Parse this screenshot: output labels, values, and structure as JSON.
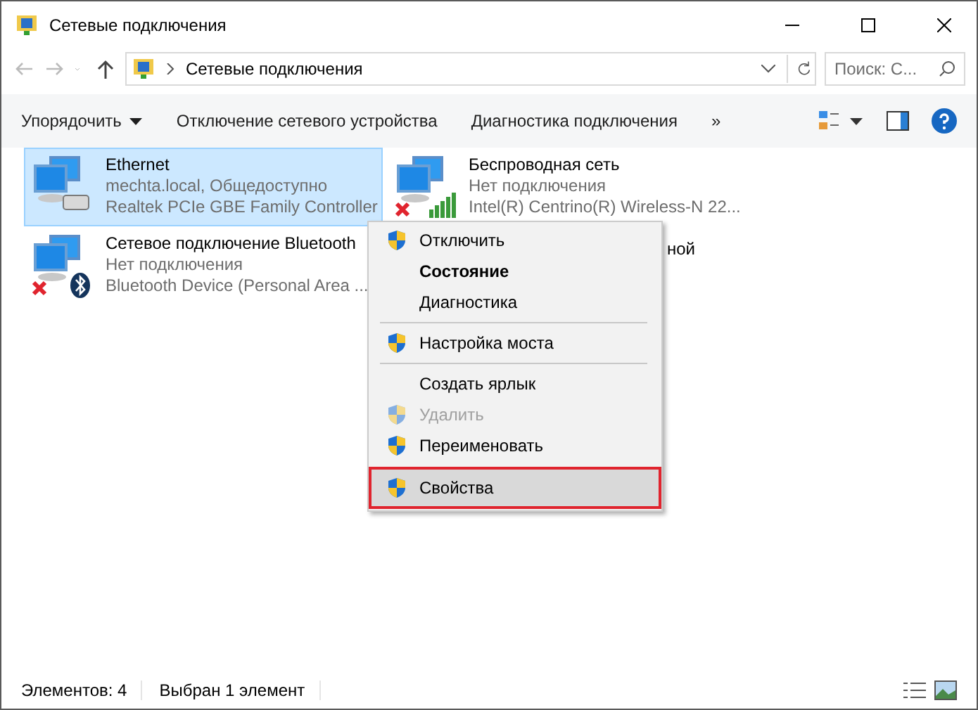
{
  "window": {
    "title": "Сетевые подключения"
  },
  "address": {
    "path": "Сетевые подключения",
    "search_placeholder": "Поиск: С..."
  },
  "commands": [
    {
      "label": "Упорядочить",
      "dropdown": true
    },
    {
      "label": "Отключение сетевого устройства",
      "dropdown": false
    },
    {
      "label": "Диагностика подключения",
      "dropdown": false
    },
    {
      "label": "»",
      "dropdown": false
    }
  ],
  "connections": [
    {
      "name": "Ethernet",
      "status": "mechta.local, Общедоступно",
      "device": "Realtek PCIe GBE Family Controller",
      "selected": true,
      "kind": "ethernet",
      "disconnected": false
    },
    {
      "name": "Беспроводная сеть",
      "status": "Нет подключения",
      "device": "Intel(R) Centrino(R) Wireless-N 22...",
      "selected": false,
      "kind": "wireless",
      "disconnected": true
    },
    {
      "name": "Сетевое подключение Bluetooth",
      "status": "Нет подключения",
      "device": "Bluetooth Device (Personal Area ...",
      "selected": false,
      "kind": "bluetooth",
      "disconnected": true
    },
    {
      "name": "ной",
      "selected": false,
      "kind": "hidden"
    }
  ],
  "context_menu": [
    {
      "kind": "item",
      "label": "Отключить",
      "shield": true,
      "bold": false,
      "disabled": false,
      "selected": false
    },
    {
      "kind": "item",
      "label": "Состояние",
      "shield": false,
      "bold": true,
      "disabled": false,
      "selected": false
    },
    {
      "kind": "item",
      "label": "Диагностика",
      "shield": false,
      "bold": false,
      "disabled": false,
      "selected": false
    },
    {
      "kind": "separator"
    },
    {
      "kind": "item",
      "label": "Настройка моста",
      "shield": true,
      "bold": false,
      "disabled": false,
      "selected": false
    },
    {
      "kind": "separator"
    },
    {
      "kind": "item",
      "label": "Создать ярлык",
      "shield": false,
      "bold": false,
      "disabled": false,
      "selected": false
    },
    {
      "kind": "item",
      "label": "Удалить",
      "shield": true,
      "bold": false,
      "disabled": true,
      "selected": false
    },
    {
      "kind": "item",
      "label": "Переименовать",
      "shield": true,
      "bold": false,
      "disabled": false,
      "selected": false
    },
    {
      "kind": "item",
      "label": "Свойства",
      "shield": true,
      "bold": false,
      "disabled": false,
      "selected": true
    }
  ],
  "status_bar": {
    "count": "Элементов: 4",
    "selection": "Выбран 1 элемент"
  }
}
